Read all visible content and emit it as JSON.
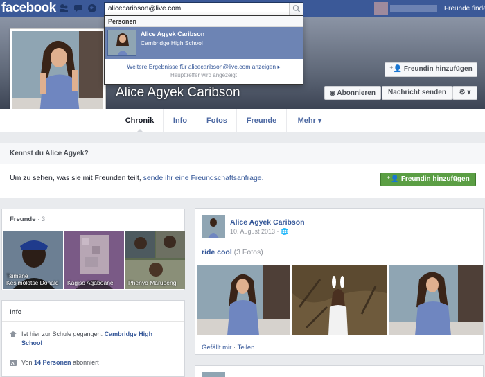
{
  "topbar": {
    "logo": "facebook",
    "search_value": "alicecaribson@live.com",
    "find_friends": "Freunde finden"
  },
  "search_dropdown": {
    "section": "Personen",
    "result": {
      "name": "Alice Agyek Caribson",
      "subtitle": "Cambridge High School"
    },
    "more": "Weitere Ergebnisse für alicecaribson@live.com anzeigen ▸",
    "more_note": "Haupttreffer wird angezeigt"
  },
  "profile": {
    "name": "Alice Agyek Caribson",
    "add_friend": "Freundin hinzufügen",
    "follow": "Abonnieren",
    "message": "Nachricht senden",
    "gear": "⚙ ▾"
  },
  "tabs": [
    "Chronik",
    "Info",
    "Fotos",
    "Freunde",
    "Mehr ▾"
  ],
  "know": {
    "title": "Kennst du Alice Agyek?",
    "text_before": "Um zu sehen, was sie mit Freunden teilt, ",
    "text_link": "sende ihr eine Freundschaftsanfrage.",
    "button": "Freundin hinzufügen"
  },
  "friends": {
    "title": "Freunde",
    "count": " · 3",
    "items": [
      {
        "name": "Tsimane Kesimolotse Donald"
      },
      {
        "name": "Kagiso Agaboane"
      },
      {
        "name": "Phenyo Marupeng"
      }
    ]
  },
  "info": {
    "title": "Info",
    "school_prefix": "Ist hier zur Schule gegangen: ",
    "school": "Cambridge High School",
    "followers_prefix": "Von ",
    "followers": "14 Personen",
    "followers_suffix": " abonniert"
  },
  "post": {
    "author": "Alice Agyek Caribson",
    "date": "10. August 2013 · 🌐",
    "album": "ride cool",
    "album_count": " (3 Fotos)",
    "like": "Gefällt mir",
    "separator": " · ",
    "share": "Teilen"
  },
  "colors": {
    "brand": "#3b5998",
    "link": "#365899",
    "green_button": "#5b9e44"
  }
}
